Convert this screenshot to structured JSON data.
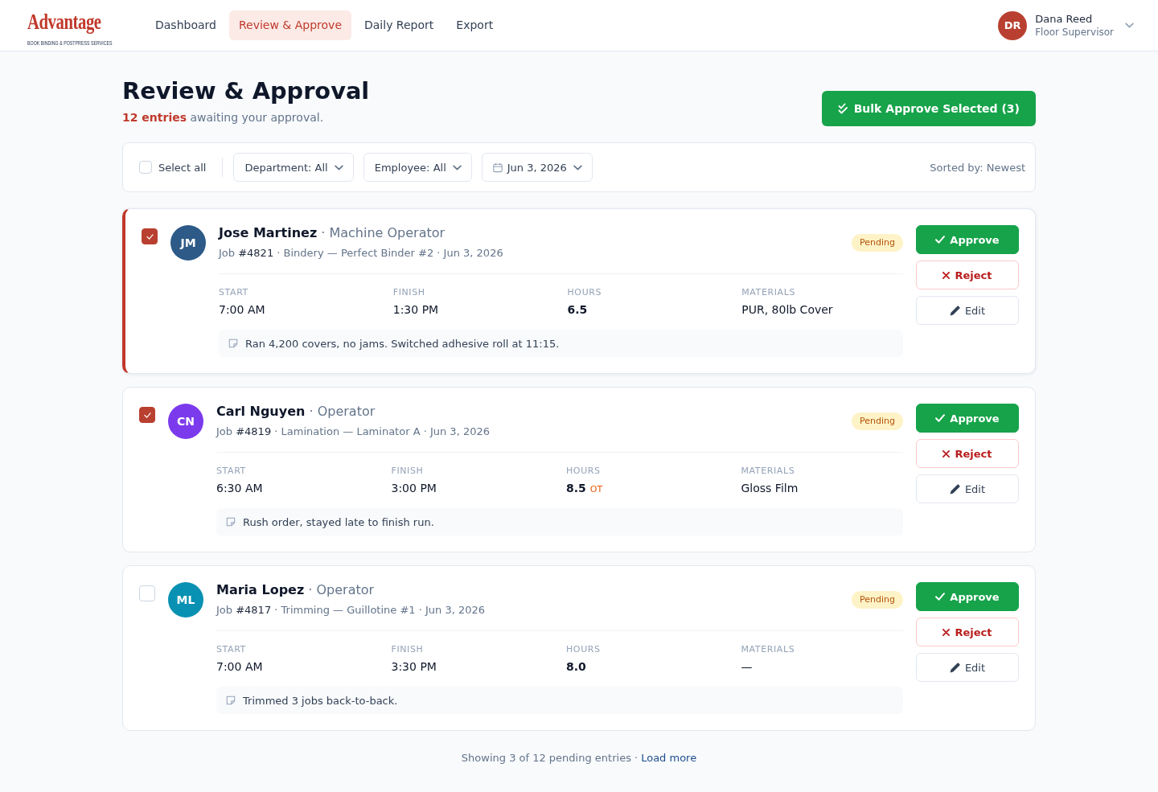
{
  "header": {
    "logo": {
      "wordmark": "Advantage",
      "tagline": "BOOK BINDING & POSTPRESS SERVICES"
    },
    "nav": [
      {
        "label": "Dashboard",
        "selected": false
      },
      {
        "label": "Review & Approve",
        "selected": true
      },
      {
        "label": "Daily Report",
        "selected": false
      },
      {
        "label": "Export",
        "selected": false
      }
    ],
    "user": {
      "initials": "DR",
      "name": "Dana Reed",
      "role": "Floor Supervisor"
    }
  },
  "page": {
    "title": "Review & Approval",
    "subtitle": "**12 entries** awaiting your approval.",
    "bulk_action": "Bulk Approve Selected (3)"
  },
  "filters": {
    "select_all": {
      "label": "Select all",
      "checked": false
    },
    "dropdowns": [
      {
        "kind": "select",
        "label": "Department: All"
      },
      {
        "kind": "select",
        "label": "Employee: All"
      },
      {
        "kind": "date",
        "label": "Jun 3, 2026"
      }
    ],
    "sort": "Sorted by: Newest"
  },
  "entries": [
    {
      "selected": true,
      "checked": true,
      "initials": "JM",
      "color": "#2d5a87",
      "heading": "**Jose Martinez** · Machine Operator",
      "details": "Job **#4821** · Bindery — Perfect Binder #2 · Jun 3, 2026",
      "status": "Pending",
      "stats": [
        {
          "kind": "plain",
          "label": "START",
          "value": "7:00 AM"
        },
        {
          "kind": "plain",
          "label": "FINISH",
          "value": "1:30 PM"
        },
        {
          "kind": "total",
          "label": "HOURS",
          "value": "6.5"
        },
        {
          "kind": "plain",
          "label": "MATERIALS",
          "value": "PUR, 80lb Cover"
        }
      ],
      "note": "Ran 4,200 covers, no jams. Switched adhesive roll at 11:15.",
      "actions": [
        {
          "kind": "approve",
          "label": "Approve"
        },
        {
          "kind": "reject",
          "label": "Reject"
        },
        {
          "kind": "edit",
          "label": "Edit"
        }
      ]
    },
    {
      "selected": false,
      "checked": true,
      "initials": "CN",
      "color": "#7c3aed",
      "heading": "**Carl Nguyen** · Operator",
      "details": "Job **#4819** · Lamination — Laminator A · Jun 3, 2026",
      "status": "Pending",
      "stats": [
        {
          "kind": "plain",
          "label": "START",
          "value": "6:30 AM"
        },
        {
          "kind": "plain",
          "label": "FINISH",
          "value": "3:00 PM"
        },
        {
          "kind": "total",
          "label": "HOURS",
          "value": "8.5",
          "tag": "OT"
        },
        {
          "kind": "plain",
          "label": "MATERIALS",
          "value": "Gloss Film"
        }
      ],
      "note": "Rush order, stayed late to finish run.",
      "actions": [
        {
          "kind": "approve",
          "label": "Approve"
        },
        {
          "kind": "reject",
          "label": "Reject"
        },
        {
          "kind": "edit",
          "label": "Edit"
        }
      ]
    },
    {
      "selected": false,
      "checked": false,
      "initials": "ML",
      "color": "#0891b2",
      "heading": "**Maria Lopez** · Operator",
      "details": "Job **#4817** · Trimming — Guillotine #1 · Jun 3, 2026",
      "status": "Pending",
      "stats": [
        {
          "kind": "plain",
          "label": "START",
          "value": "7:00 AM"
        },
        {
          "kind": "plain",
          "label": "FINISH",
          "value": "3:30 PM"
        },
        {
          "kind": "total",
          "label": "HOURS",
          "value": "8.0"
        },
        {
          "kind": "plain",
          "label": "MATERIALS",
          "value": "—"
        }
      ],
      "note": "Trimmed 3 jobs back-to-back.",
      "actions": [
        {
          "kind": "approve",
          "label": "Approve"
        },
        {
          "kind": "reject",
          "label": "Reject"
        },
        {
          "kind": "edit",
          "label": "Edit"
        }
      ]
    }
  ],
  "footer": {
    "summary": "Showing 3 of 12 pending entries ·",
    "link": "Load more"
  }
}
